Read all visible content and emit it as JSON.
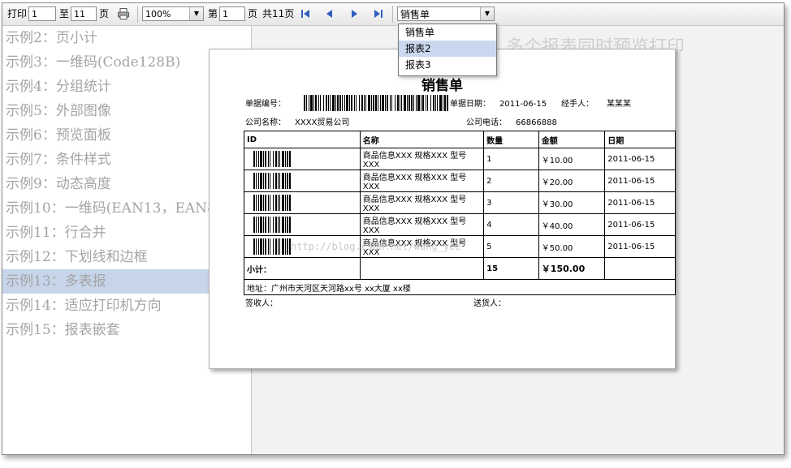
{
  "toolbar": {
    "print_label": "打印",
    "from_value": "1",
    "to_label": "至",
    "to_value": "11",
    "page_unit": "页",
    "zoom": "100%",
    "page_prefix": "第",
    "current_page": "1",
    "page_suffix": "页",
    "total_pages": "共11页",
    "report_selected": "销售单"
  },
  "dropdown": {
    "options": [
      "销售单",
      "报表2",
      "报表3"
    ],
    "highlighted": "报表2"
  },
  "sidebar": {
    "items": [
      "示例2：页小计",
      "示例3：一维码(Code128B)",
      "示例4：分组统计",
      "示例5：外部图像",
      "示例6：预览面板",
      "示例7：条件样式",
      "示例9：动态高度",
      "示例10：一维码(EAN13，EAN8",
      "示例11：行合并",
      "示例12：下划线和边框",
      "示例13：多表报",
      "示例14：适应打印机方向",
      "示例15：报表嵌套"
    ],
    "selected_index": 10
  },
  "preview": {
    "background_title": "多个报表同时预览打印",
    "report": {
      "title": "销售单",
      "doc_no_label": "单据编号：",
      "doc_date_label": "单据日期：",
      "doc_date": "2011-06-15",
      "handler_label": "经手人：",
      "handler": "某某某",
      "company_label": "公司名称：",
      "company": "XXXX贸易公司",
      "phone_label": "公司电话：",
      "phone": "66866888",
      "headers": [
        "ID",
        "名称",
        "数量",
        "金额",
        "日期"
      ],
      "rows": [
        {
          "name": "商品信息XXX 规格XXX 型号XXX",
          "qty": "1",
          "amount": "￥10.00",
          "date": "2011-06-15"
        },
        {
          "name": "商品信息XXX 规格XXX 型号XXX",
          "qty": "2",
          "amount": "￥20.00",
          "date": "2011-06-15"
        },
        {
          "name": "商品信息XXX 规格XXX 型号XXX",
          "qty": "3",
          "amount": "￥30.00",
          "date": "2011-06-15"
        },
        {
          "name": "商品信息XXX 规格XXX 型号XXX",
          "qty": "4",
          "amount": "￥40.00",
          "date": "2011-06-15"
        },
        {
          "name": "商品信息XXX 规格XXX 型号XXX",
          "qty": "5",
          "amount": "￥50.00",
          "date": "2011-06-15"
        }
      ],
      "subtotal_label": "小计：",
      "subtotal_qty": "15",
      "subtotal_amount": "￥150.00",
      "address": "地址：广州市天河区天河路xx号 xx大厦 xx楼",
      "receiver_label": "签收人：",
      "sender_label": "送货人：",
      "watermark": "http://blog.csdn.net/wang_yee"
    }
  }
}
